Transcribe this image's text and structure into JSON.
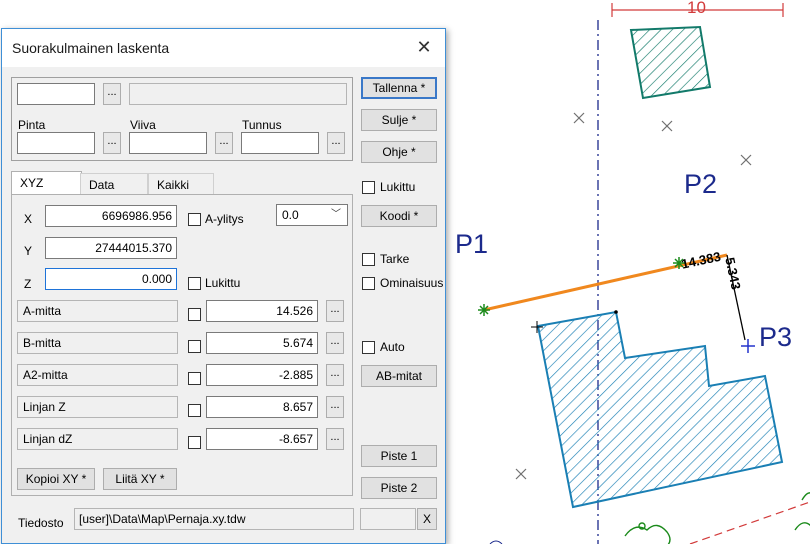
{
  "map": {
    "points": [
      {
        "id": "p1",
        "label": "P1"
      },
      {
        "id": "p2",
        "label": "P2"
      },
      {
        "id": "p3",
        "label": "P3"
      }
    ],
    "dimension_label": "10",
    "measure_a": "14.383",
    "measure_b": "5.343"
  },
  "dialog": {
    "title": "Suorakulmainen laskenta",
    "fields_top": {
      "code_value": "",
      "desc_value": "",
      "pinta_label": "Pinta",
      "viiva_label": "Viiva",
      "tunnus_label": "Tunnus",
      "pinta_value": "",
      "viiva_value": "",
      "tunnus_value": ""
    },
    "dots": "...",
    "buttons": {
      "tallenna": "Tallenna *",
      "sulje": "Sulje *",
      "ohje": "Ohje *",
      "koodi": "Koodi *",
      "ab_mitat": "AB-mitat",
      "piste1": "Piste 1",
      "piste2": "Piste 2",
      "kopioi": "Kopioi XY *",
      "liita": "Liitä XY *",
      "x_small": "X"
    },
    "right_checks": {
      "lukittu": "Lukittu",
      "tarke": "Tarke",
      "ominaisuus": "Ominaisuus",
      "auto": "Auto"
    },
    "tabs": [
      "XYZ",
      "Data",
      "Kaikki"
    ],
    "xyz": {
      "x_label": "X",
      "x_value": "6696986.956",
      "y_label": "Y",
      "y_value": "27444015.370",
      "z_label": "Z",
      "z_value": "0.000",
      "a_ylitys": "A-ylitys",
      "combo_value": "0.0",
      "z_lukittu": "Lukittu"
    },
    "measures": [
      {
        "label": "A-mitta",
        "value": "14.526"
      },
      {
        "label": "B-mitta",
        "value": "5.674"
      },
      {
        "label": "A2-mitta",
        "value": "-2.885"
      },
      {
        "label": "Linjan Z",
        "value": "8.657"
      },
      {
        "label": "Linjan dZ",
        "value": "-8.657"
      }
    ],
    "tiedosto_label": "Tiedosto",
    "tiedosto_value": "[user]\\Data\\Map\\Pernaja.xy.tdw",
    "small_field": ""
  }
}
